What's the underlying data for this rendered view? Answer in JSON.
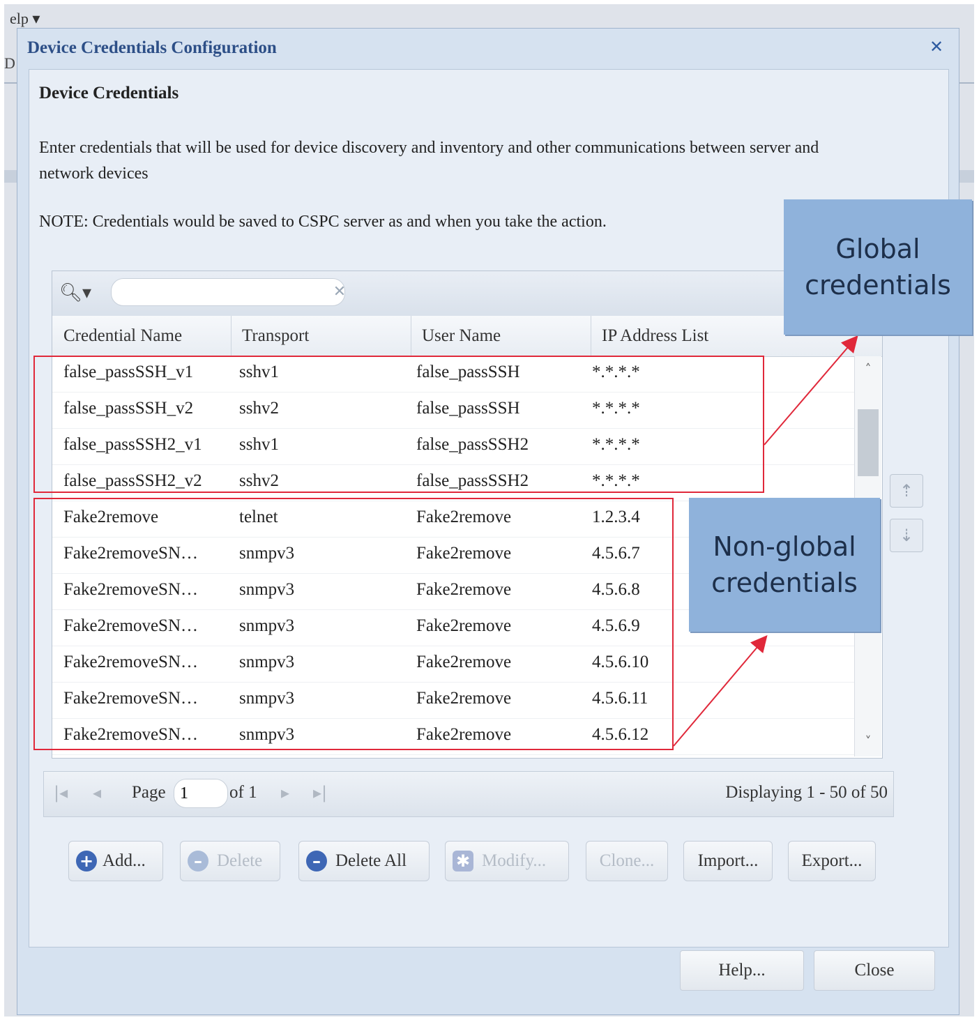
{
  "menu": {
    "help": "elp ▾",
    "side_letter": "D"
  },
  "dialog": {
    "title": "Device Credentials Configuration",
    "section_title": "Device Credentials",
    "description": "Enter credentials that will be used for device discovery and inventory and other communications between server and network devices",
    "note": "NOTE: Credentials would be saved to CSPC server as and when you take the action."
  },
  "search": {
    "placeholder": "",
    "value": ""
  },
  "columns": [
    "Credential Name",
    "Transport",
    "User Name",
    "IP Address List"
  ],
  "rows": [
    {
      "name": "false_passSSH_v1",
      "transport": "sshv1",
      "user": "false_passSSH",
      "ip": "*.*.*.*"
    },
    {
      "name": "false_passSSH_v2",
      "transport": "sshv2",
      "user": "false_passSSH",
      "ip": "*.*.*.*"
    },
    {
      "name": "false_passSSH2_v1",
      "transport": "sshv1",
      "user": "false_passSSH2",
      "ip": "*.*.*.*"
    },
    {
      "name": "false_passSSH2_v2",
      "transport": "sshv2",
      "user": "false_passSSH2",
      "ip": "*.*.*.*"
    },
    {
      "name": "Fake2remove",
      "transport": "telnet",
      "user": "Fake2remove",
      "ip": "1.2.3.4"
    },
    {
      "name": "Fake2removeSN…",
      "transport": "snmpv3",
      "user": "Fake2remove",
      "ip": "4.5.6.7"
    },
    {
      "name": "Fake2removeSN…",
      "transport": "snmpv3",
      "user": "Fake2remove",
      "ip": "4.5.6.8"
    },
    {
      "name": "Fake2removeSN…",
      "transport": "snmpv3",
      "user": "Fake2remove",
      "ip": "4.5.6.9"
    },
    {
      "name": "Fake2removeSN…",
      "transport": "snmpv3",
      "user": "Fake2remove",
      "ip": "4.5.6.10"
    },
    {
      "name": "Fake2removeSN…",
      "transport": "snmpv3",
      "user": "Fake2remove",
      "ip": "4.5.6.11"
    },
    {
      "name": "Fake2removeSN…",
      "transport": "snmpv3",
      "user": "Fake2remove",
      "ip": "4.5.6.12"
    }
  ],
  "pager": {
    "page_label": "Page",
    "page_value": "1",
    "of_label": "of 1",
    "displaying": "Displaying 1 - 50 of 50"
  },
  "actions": {
    "add": "Add...",
    "delete": "Delete",
    "delete_all": "Delete All",
    "modify": "Modify...",
    "clone": "Clone...",
    "import": "Import...",
    "export": "Export..."
  },
  "footer": {
    "help": "Help...",
    "close": "Close"
  },
  "callouts": {
    "global": "Global credentials",
    "non_global": "Non-global credentials"
  },
  "colors": {
    "annotation_red": "#e0283a",
    "callout_blue": "#8fb2db",
    "title_blue": "#2d4f87"
  }
}
